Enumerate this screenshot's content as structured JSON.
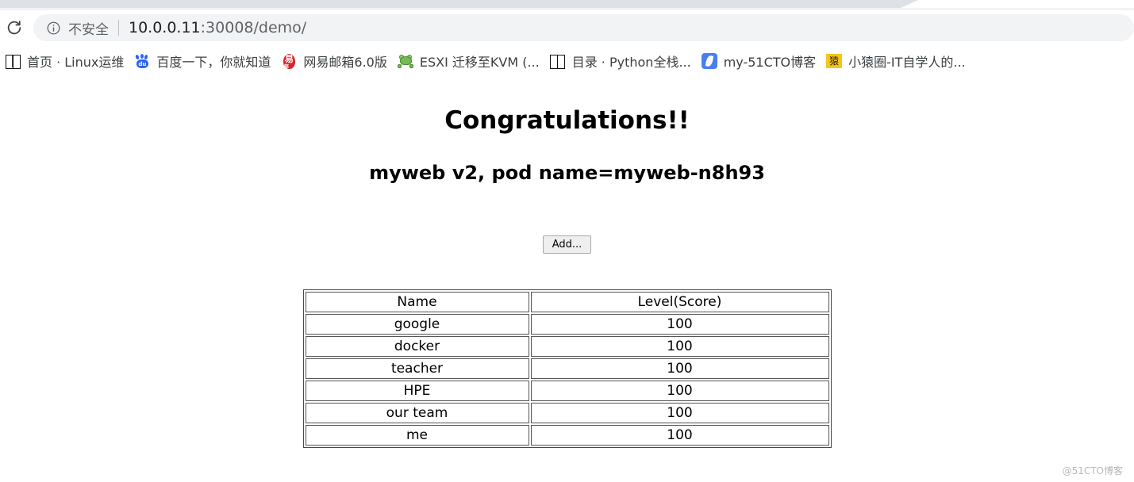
{
  "browser": {
    "reload_icon": "reload-icon",
    "omnibox": {
      "info_icon": "info-circle-icon",
      "security_label": "不安全",
      "url_host": "10.0.0.11",
      "url_path": ":30008/demo/",
      "full_url": "10.0.0.11:30008/demo/"
    },
    "bookmarks": [
      {
        "label": "首页 · Linux运维",
        "icon": "open-book-icon"
      },
      {
        "label": "百度一下，你就知道",
        "icon": "baidu-paw-icon"
      },
      {
        "label": "网易邮箱6.0版",
        "icon": "netease-mail-icon"
      },
      {
        "label": "ESXI 迁移至KVM (...",
        "icon": "frog-icon"
      },
      {
        "label": "目录 · Python全栈...",
        "icon": "open-book-icon"
      },
      {
        "label": "my-51CTO博客",
        "icon": "51cto-feather-icon"
      },
      {
        "label": "小猿圈-IT自学人的...",
        "icon": "yuan-badge-icon"
      }
    ]
  },
  "page": {
    "title": "Congratulations!!",
    "subtitle": "myweb v2, pod name=myweb-n8h93",
    "add_button_label": "Add...",
    "table": {
      "headers": [
        "Name",
        "Level(Score)"
      ],
      "rows": [
        [
          "google",
          "100"
        ],
        [
          "docker",
          "100"
        ],
        [
          "teacher",
          "100"
        ],
        [
          "HPE",
          "100"
        ],
        [
          "our team",
          "100"
        ],
        [
          "me",
          "100"
        ]
      ]
    }
  },
  "watermark": "@51CTO博客",
  "colors": {
    "tabstrip": "#dee1e6",
    "omnibox_bg": "#f1f3f4",
    "url_host": "#202124",
    "url_path": "#5f6368",
    "baidu_blue": "#2c64f5",
    "netease_red": "#d9262c",
    "frog_green": "#73bb52",
    "cto_blue": "#4a7ef0",
    "yuan_yellow": "#f5c518"
  }
}
